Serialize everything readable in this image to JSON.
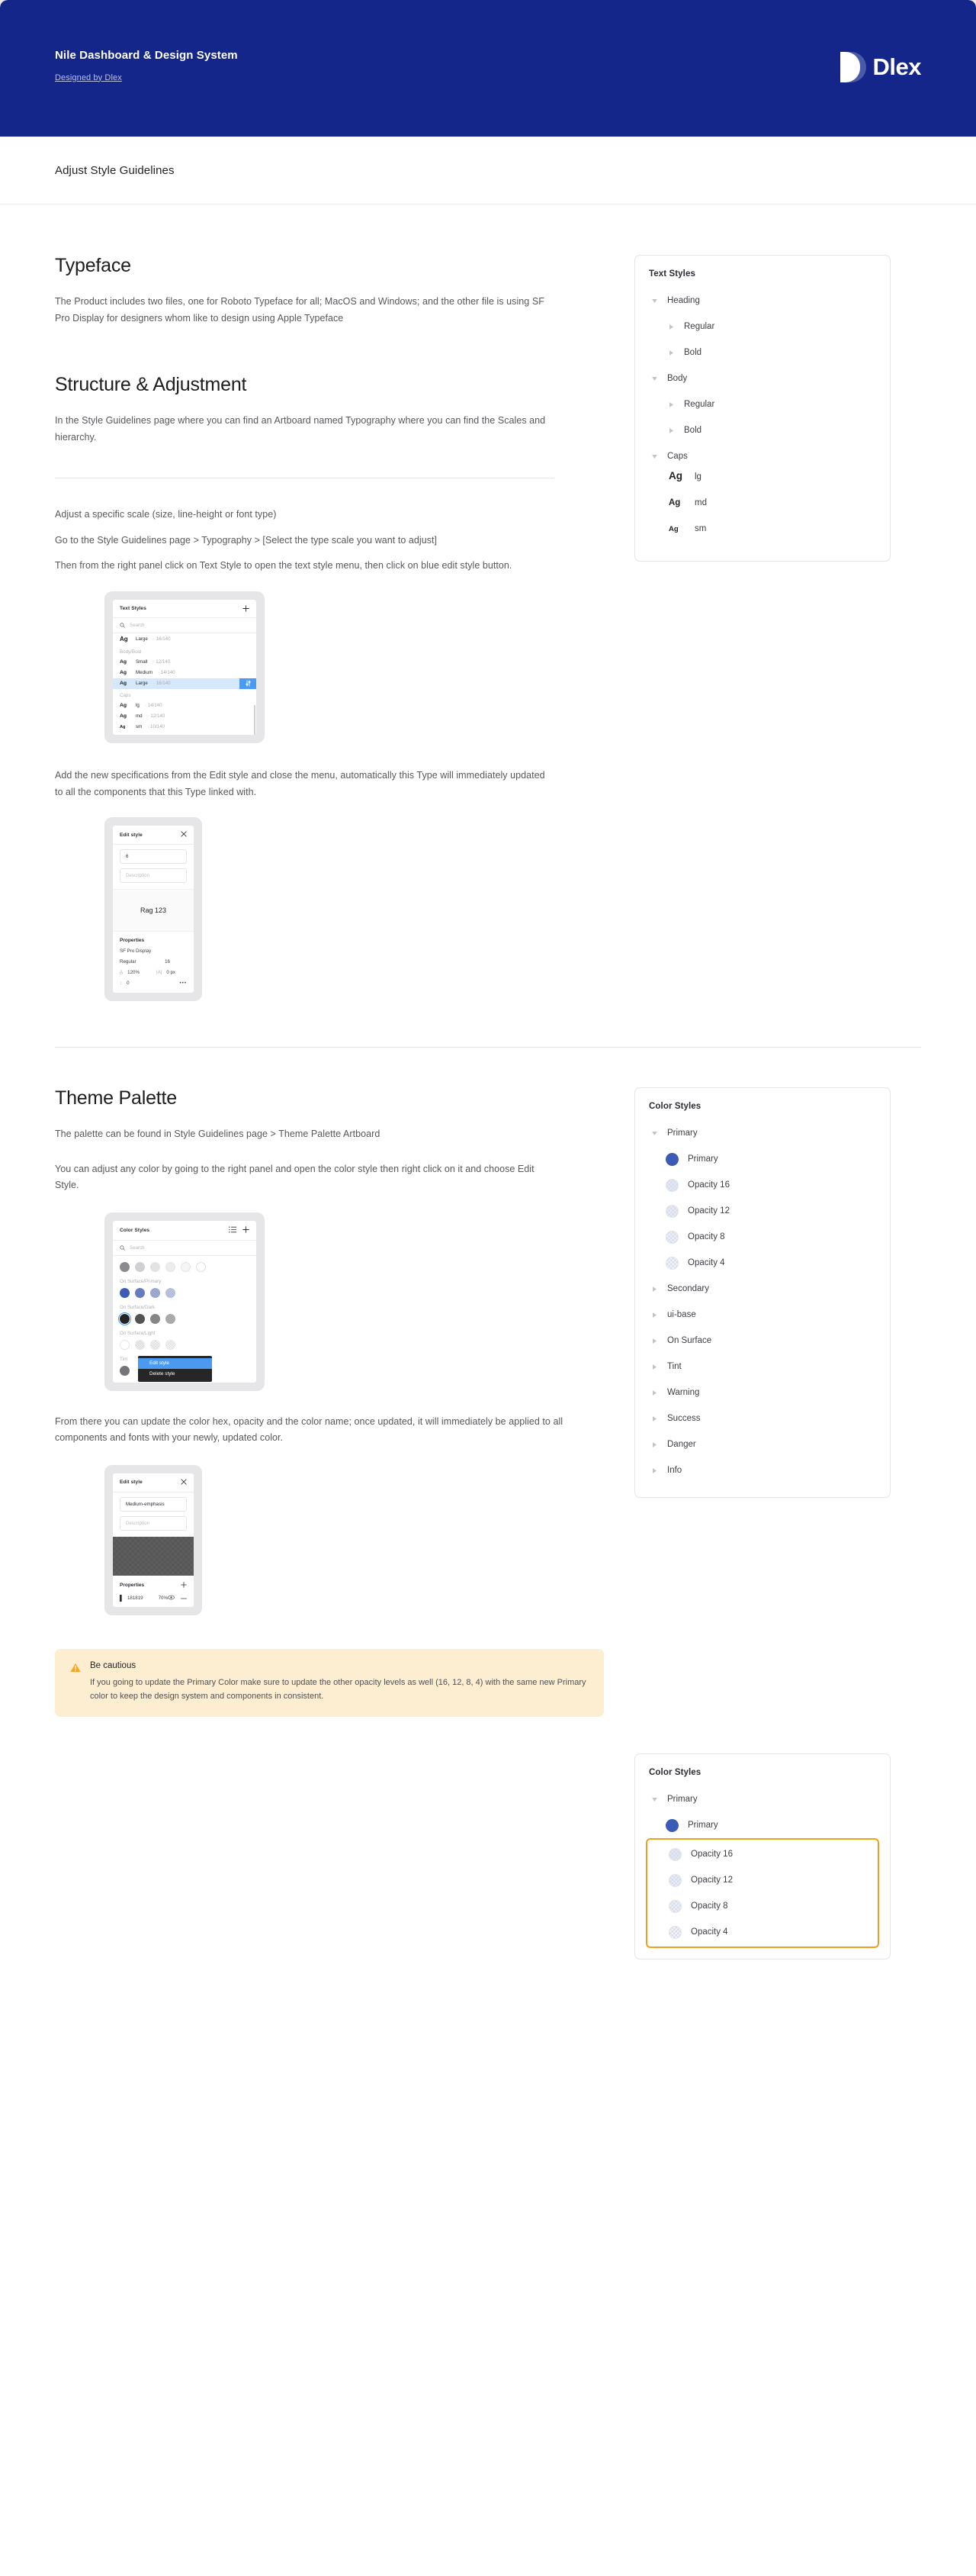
{
  "hero": {
    "title": "Nile Dashboard & Design System",
    "subtitle": "Designed by Dlex",
    "brand": "Dlex"
  },
  "subheader": {
    "title": "Adjust Style Guidelines"
  },
  "sections": {
    "typeface": {
      "heading": "Typeface",
      "paragraph": "The Product includes two files, one for Roboto Typeface for all; MacOS and Windows; and the other file is using SF Pro Display for designers whom like to design using Apple Typeface"
    },
    "structure": {
      "heading": "Structure & Adjustment",
      "paragraph": "In the Style Guidelines page where you can find an Artboard named Typography where you can find the Scales and hierarchy.",
      "step1": "Adjust a specific scale (size, line-height or font type)",
      "step2": "Go to the Style Guidelines page > Typography > [Select the type scale you want to adjust]",
      "step3": "Then from the right panel click on Text Style to open the text style menu, then click on blue edit style button.",
      "step4": "Add the new specifications from the Edit style and close the menu, automatically this Type will immediately updated to all the components that this Type linked with."
    },
    "theme": {
      "heading": "Theme Palette",
      "paragraph1": "The palette can be found in Style Guidelines page > Theme Palette Artboard",
      "paragraph2": "You can adjust any color by going to the right panel and open the color style then right click on it and choose Edit Style.",
      "paragraph3": "From there you can update the color hex, opacity and the color name; once updated, it will immediately be applied to all components and fonts with your newly, updated color."
    }
  },
  "text_styles_panel": {
    "title": "Text Styles",
    "items": [
      {
        "label": "Heading",
        "level": 1,
        "caret": "down"
      },
      {
        "label": "Regular",
        "level": 2,
        "caret": "right"
      },
      {
        "label": "Bold",
        "level": 2,
        "caret": "right"
      },
      {
        "label": "Body",
        "level": 1,
        "caret": "down"
      },
      {
        "label": "Regular",
        "level": 2,
        "caret": "right"
      },
      {
        "label": "Bold",
        "level": 2,
        "caret": "right"
      },
      {
        "label": "Caps",
        "level": 1,
        "caret": "down"
      }
    ],
    "caps": [
      {
        "ag": "Ag",
        "label": "lg",
        "size": "lg"
      },
      {
        "ag": "Ag",
        "label": "md",
        "size": "md"
      },
      {
        "ag": "Ag",
        "label": "sm",
        "size": "sm"
      }
    ]
  },
  "color_styles_panel": {
    "title": "Color Styles",
    "primary_group": {
      "label": "Primary",
      "caret": "down"
    },
    "primary_items": [
      {
        "label": "Primary",
        "swatch": "primary"
      },
      {
        "label": "Opacity 16",
        "swatch": "c16"
      },
      {
        "label": "Opacity 12",
        "swatch": "c12"
      },
      {
        "label": "Opacity 8",
        "swatch": "c8"
      },
      {
        "label": "Opacity 4",
        "swatch": "c4"
      }
    ],
    "groups": [
      {
        "label": "Secondary",
        "caret": "right"
      },
      {
        "label": "ui-base",
        "caret": "right"
      },
      {
        "label": "On Surface",
        "caret": "right"
      },
      {
        "label": "Tint",
        "caret": "right"
      },
      {
        "label": "Warning",
        "caret": "right"
      },
      {
        "label": "Success",
        "caret": "right"
      },
      {
        "label": "Danger",
        "caret": "right"
      },
      {
        "label": "Info",
        "caret": "right"
      }
    ]
  },
  "color_styles_panel_bottom": {
    "title": "Color Styles",
    "primary_group": {
      "label": "Primary"
    },
    "primary_item": {
      "label": "Primary"
    },
    "highlighted": [
      {
        "label": "Opacity 16",
        "swatch": "c16"
      },
      {
        "label": "Opacity 12",
        "swatch": "c12"
      },
      {
        "label": "Opacity 8",
        "swatch": "c8"
      },
      {
        "label": "Opacity 4",
        "swatch": "c4"
      }
    ],
    "highlight_color": "#f0a020"
  },
  "mock_text_styles": {
    "title": "Text Styles",
    "add_icon": "plus-icon",
    "search_placeholder": "Search",
    "rows": [
      {
        "kind": "item",
        "ag": "Ag",
        "size": "big",
        "name": "Large",
        "dim": "· 16/140"
      },
      {
        "kind": "group",
        "label": "Body/Bold"
      },
      {
        "kind": "item",
        "ag": "Ag",
        "size": "mid",
        "name": "Small",
        "dim": "· 12/140"
      },
      {
        "kind": "item",
        "ag": "Ag",
        "size": "mid",
        "name": "Medium",
        "dim": "· 14/140"
      },
      {
        "kind": "item",
        "ag": "Ag",
        "size": "mid",
        "name": "Large",
        "dim": "· 16/140",
        "selected": true
      },
      {
        "kind": "group",
        "label": "Caps"
      },
      {
        "kind": "item",
        "ag": "Ag",
        "size": "mid",
        "name": "lg",
        "dim": "· 14/140"
      },
      {
        "kind": "item",
        "ag": "Ag",
        "size": "mid",
        "name": "md",
        "dim": "· 12/140"
      },
      {
        "kind": "item",
        "ag": "Ag",
        "size": "sml",
        "name": "sm",
        "dim": "· 10/140"
      }
    ]
  },
  "mock_edit_type": {
    "title": "Edit style",
    "close_icon": "close-icon",
    "name_value": "6",
    "description_placeholder": "Description",
    "preview_text": "Rag 123",
    "properties_label": "Properties",
    "font_family": "SF Pro Display",
    "weight": "Regular",
    "size": "16",
    "line_height": "120%",
    "letter_spacing": "0 px",
    "paragraph_spacing": "0",
    "more_icon": "more-icon"
  },
  "mock_color_styles": {
    "title": "Color Styles",
    "list_icon": "list-icon",
    "add_icon": "plus-icon",
    "search_placeholder": "Search",
    "groups": [
      {
        "label": "On Surface/Primary"
      },
      {
        "label": "On Surface/Dark"
      },
      {
        "label": "On Surface/Light"
      },
      {
        "label": "Tint"
      }
    ],
    "context_menu": {
      "edit": "Edit style",
      "delete": "Delete style"
    }
  },
  "mock_edit_color": {
    "title": "Edit style",
    "close_icon": "close-icon",
    "name_value": "Medium-emphasis",
    "description_placeholder": "Description",
    "properties_label": "Properties",
    "add_icon": "plus-icon",
    "hex": "181819",
    "opacity": "70%",
    "eye_icon": "eye-icon",
    "minus_icon": "minus-icon"
  },
  "warning": {
    "icon": "warning-triangle-icon",
    "title": "Be cautious",
    "text": "If you going to update the Primary Color make sure to update the other opacity levels as well (16, 12, 8, 4) with the same new Primary color to keep the design system and components in consistent."
  }
}
